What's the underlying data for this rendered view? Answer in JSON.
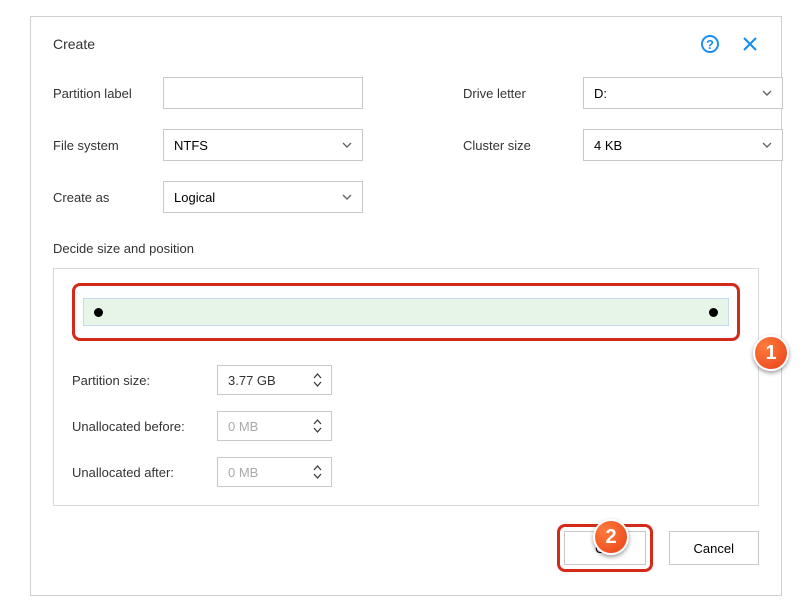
{
  "title": "Create",
  "fields": {
    "partition_label": {
      "label": "Partition label",
      "value": ""
    },
    "file_system": {
      "label": "File system",
      "value": "NTFS"
    },
    "create_as": {
      "label": "Create as",
      "value": "Logical"
    },
    "drive_letter": {
      "label": "Drive letter",
      "value": "D:"
    },
    "cluster_size": {
      "label": "Cluster size",
      "value": "4 KB"
    }
  },
  "section": "Decide size and position",
  "sizes": {
    "partition_size": {
      "label": "Partition size:",
      "value": "3.77 GB"
    },
    "unalloc_before": {
      "label": "Unallocated before:",
      "value": "0 MB"
    },
    "unalloc_after": {
      "label": "Unallocated after:",
      "value": "0 MB"
    }
  },
  "buttons": {
    "ok": "OK",
    "cancel": "Cancel"
  },
  "callouts": {
    "one": "1",
    "two": "2"
  }
}
